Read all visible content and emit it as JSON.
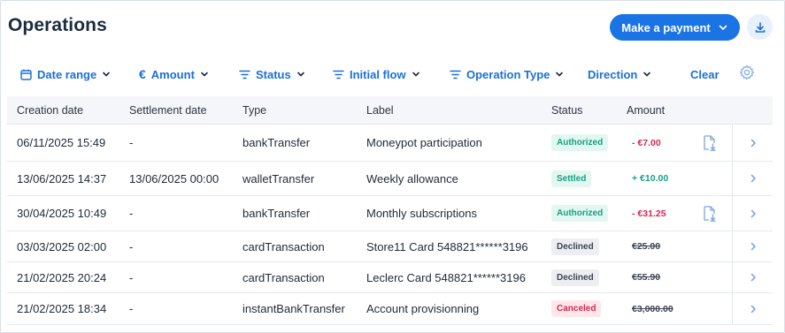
{
  "header": {
    "title": "Operations",
    "make_payment_label": "Make a payment"
  },
  "icons": {
    "download": "download-icon",
    "calendar": "calendar-icon",
    "euro": "euro-icon",
    "filter": "filter-icon",
    "gear": "gear-icon",
    "chevron_down": "chevron-down-icon",
    "chevron_right": "chevron-right-icon",
    "document_download": "document-download-icon"
  },
  "colors": {
    "accent": "#1b74e4",
    "positive": "#17a083",
    "negative": "#d9264d"
  },
  "filters": {
    "date_range": "Date range",
    "amount": "Amount",
    "status": "Status",
    "initial_flow": "Initial flow",
    "operation_type": "Operation Type",
    "direction": "Direction",
    "clear": "Clear"
  },
  "table": {
    "columns": {
      "creation_date": "Creation date",
      "settlement_date": "Settlement date",
      "type": "Type",
      "label": "Label",
      "status": "Status",
      "amount": "Amount"
    },
    "rows": [
      {
        "creation": "06/11/2025 15:49",
        "settlement": "-",
        "type": "bankTransfer",
        "label": "Moneypot participation",
        "status": "Authorized",
        "amount": "- €7.00"
      },
      {
        "creation": "13/06/2025 14:37",
        "settlement": "13/06/2025 00:00",
        "type": "walletTransfer",
        "label": "Weekly allowance",
        "status": "Settled",
        "amount": "+ €10.00"
      },
      {
        "creation": "30/04/2025 10:49",
        "settlement": "-",
        "type": "bankTransfer",
        "label": "Monthly subscriptions",
        "status": "Authorized",
        "amount": "- €31.25"
      },
      {
        "creation": "03/03/2025 02:00",
        "settlement": "-",
        "type": "cardTransaction",
        "label": "Store11 Card 548821******3196",
        "status": "Declined",
        "amount": "€25.00"
      },
      {
        "creation": "21/02/2025 20:24",
        "settlement": "-",
        "type": "cardTransaction",
        "label": "Leclerc Card 548821******3196",
        "status": "Declined",
        "amount": "€55.90"
      },
      {
        "creation": "21/02/2025 18:34",
        "settlement": "-",
        "type": "instantBankTransfer",
        "label": "Account provisionning",
        "status": "Canceled",
        "amount": "€3,000.00"
      }
    ]
  }
}
